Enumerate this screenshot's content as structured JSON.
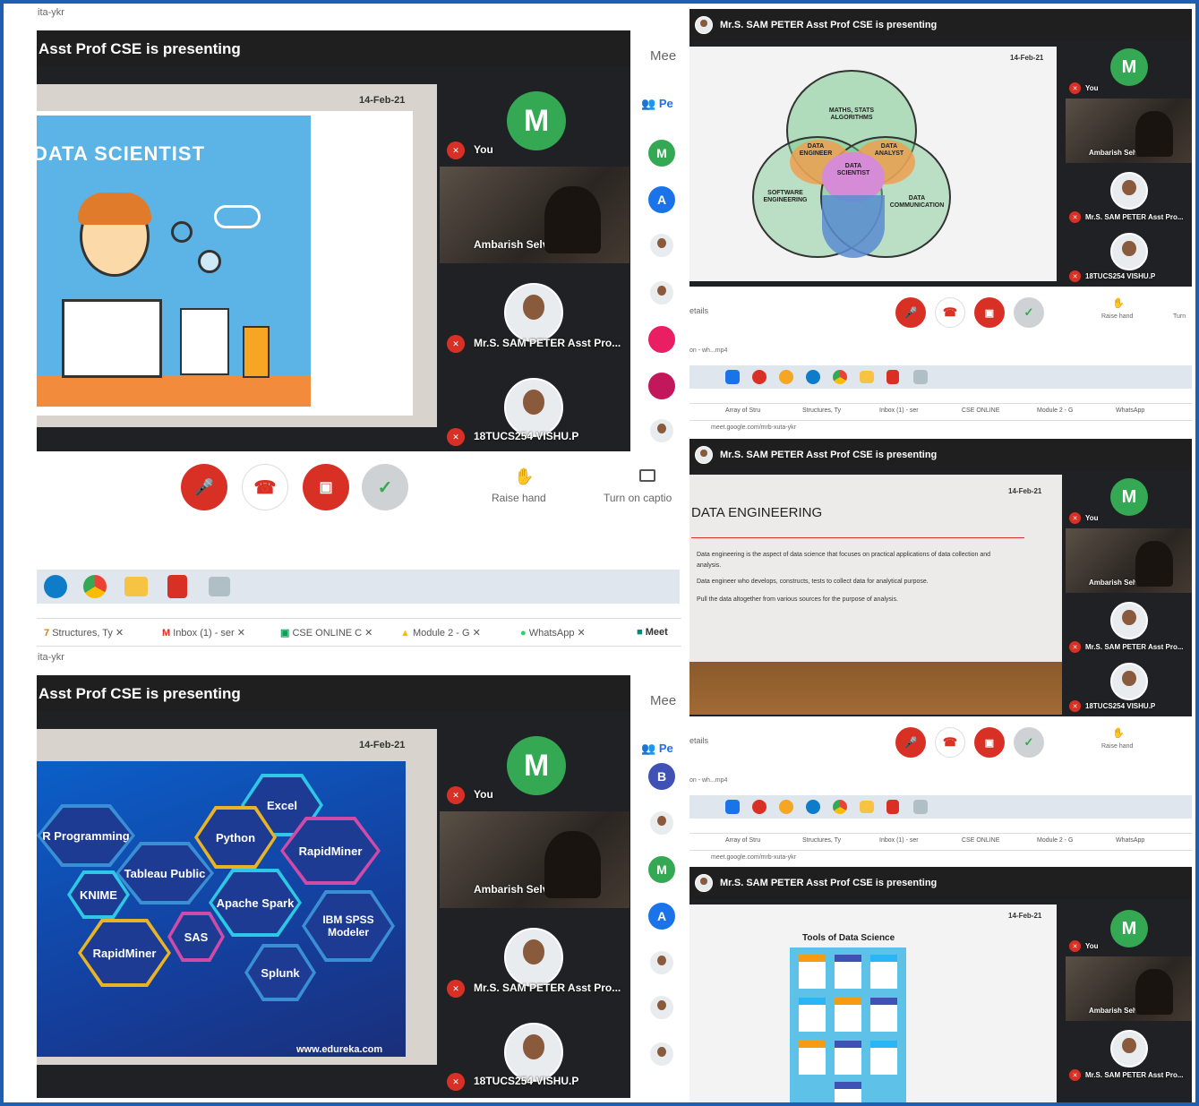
{
  "q1": {
    "url": "ita-ykr",
    "presenting": "Asst Prof CSE is presenting",
    "side_title": "Mee",
    "people_tab": "Pe",
    "date": "14-Feb-21",
    "slide_title": "DATA SCIENTIST",
    "tiles": {
      "you": "You",
      "avatar": "M",
      "ambarish": "Ambarish Selvan",
      "sam": "Mr.S. SAM PETER Asst Pro...",
      "vishu": "18TUCS254 VISHU.P"
    },
    "raise_hand": "Raise hand",
    "captions": "Turn on captio",
    "people": [
      "M",
      "A"
    ]
  },
  "tabs_mid": [
    "Structures, Ty",
    "Inbox (1) - ser",
    "CSE ONLINE C",
    "Module 2 - G",
    "WhatsApp",
    "Meet"
  ],
  "q3": {
    "url": "ita-ykr",
    "presenting": "Asst Prof CSE is presenting",
    "side_title": "Mee",
    "people_tab": "Pe",
    "date": "14-Feb-21",
    "tools": [
      "Excel",
      "R Programming",
      "Python",
      "RapidMiner",
      "Tableau Public",
      "KNIME",
      "Apache Spark",
      "IBM SPSS Modeler",
      "SAS",
      "RapidMiner",
      "Splunk"
    ],
    "watermark": "www.edureka.com",
    "tiles": {
      "you": "You",
      "avatar": "M",
      "ambarish": "Ambarish Selvan",
      "sam": "Mr.S. SAM PETER Asst Pro...",
      "vishu": "18TUCS254 VISHU.P"
    },
    "people": [
      "B",
      "M",
      "A"
    ]
  },
  "q2": {
    "presenting": "Mr.S. SAM PETER Asst Prof CSE is presenting",
    "date": "14-Feb-21",
    "venn": {
      "top": "MATHS, STATS ALGORITHMS",
      "left": "SOFTWARE ENGINEERING",
      "right": "DATA COMMUNICATION",
      "de": "DATA ENGINEER",
      "da": "DATA ANALYST",
      "ds": "DATA SCIENTIST"
    },
    "tiles": {
      "you": "You",
      "avatar": "M",
      "ambarish": "Ambarish Selvan",
      "sam": "Mr.S. SAM PETER Asst Pro...",
      "vishu": "18TUCS254 VISHU.P"
    },
    "details": "etails",
    "raise": "Raise hand",
    "turn": "Turn",
    "download": "on - wh...mp4",
    "url": "meet.google.com/mrb-xuta-ykr"
  },
  "q2b": {
    "presenting": "Mr.S. SAM PETER Asst Prof CSE is presenting",
    "date": "14-Feb-21",
    "title": "DATA ENGINEERING",
    "lines": [
      "Data engineering is the aspect of data science that focuses on practical applications of data collection and analysis.",
      "Data engineer  who develops, constructs, tests to collect data for analytical purpose.",
      "Pull the data altogether from various sources for the purpose of analysis."
    ],
    "tiles": {
      "you": "You",
      "avatar": "M",
      "ambarish": "Ambarish Selvan",
      "sam": "Mr.S. SAM PETER Asst Pro...",
      "vishu": "18TUCS254 VISHU.P"
    },
    "details": "etails",
    "raise": "Raise hand",
    "download": "on - wh...mp4",
    "url": "meet.google.com/mrb-xuta-ykr"
  },
  "q2c": {
    "presenting": "Mr.S. SAM PETER Asst Prof CSE is presenting",
    "date": "14-Feb-21",
    "title": "Tools of Data Science",
    "tiles": {
      "you": "You",
      "avatar": "M",
      "ambarish": "Ambarish Selvan",
      "sam": "Mr.S. SAM PETER Asst Pro..."
    }
  },
  "small_tabs": [
    "Array of Stru",
    "Structures, Ty",
    "Inbox (1) - ser",
    "CSE ONLINE",
    "Module 2 - G",
    "WhatsApp"
  ]
}
